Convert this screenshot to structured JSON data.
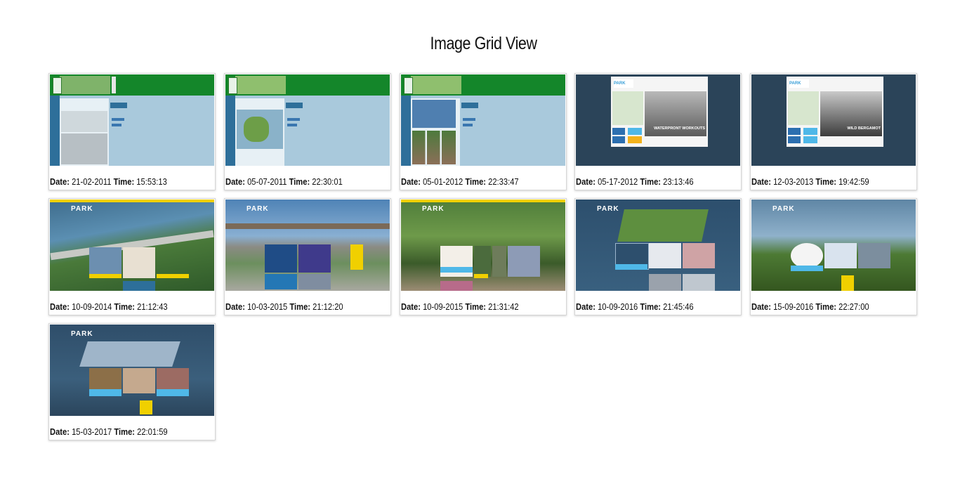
{
  "page": {
    "title": "Image Grid View"
  },
  "labels": {
    "date": "Date:",
    "time": "Time:"
  },
  "items": [
    {
      "date": "21-02-2011",
      "time": "15:53:13"
    },
    {
      "date": "05-07-2011",
      "time": "22:30:01"
    },
    {
      "date": "05-01-2012",
      "time": "22:33:47"
    },
    {
      "date": "05-17-2012",
      "time": "23:13:46",
      "hero_text": "WATERPRONT WORKOUTS"
    },
    {
      "date": "12-03-2013",
      "time": "19:42:59",
      "hero_text": "WILD BERGAMOT"
    },
    {
      "date": "10-09-2014",
      "time": "21:12:43",
      "logo": "PARK"
    },
    {
      "date": "10-03-2015",
      "time": "21:12:20",
      "logo": "PARK"
    },
    {
      "date": "10-09-2015",
      "time": "21:31:42",
      "logo": "PARK"
    },
    {
      "date": "10-09-2016",
      "time": "21:45:46",
      "logo": "PARK"
    },
    {
      "date": "15-09-2016",
      "time": "22:27:00",
      "logo": "PARK"
    },
    {
      "date": "15-03-2017",
      "time": "22:01:59",
      "logo": "PARK"
    }
  ],
  "colors": {
    "old_green": "#14862a",
    "old_blue": "#a9c9dc",
    "dark_navy": "#2b4459",
    "accent_yellow": "#f0d000",
    "accent_blue": "#3aa0d8"
  }
}
